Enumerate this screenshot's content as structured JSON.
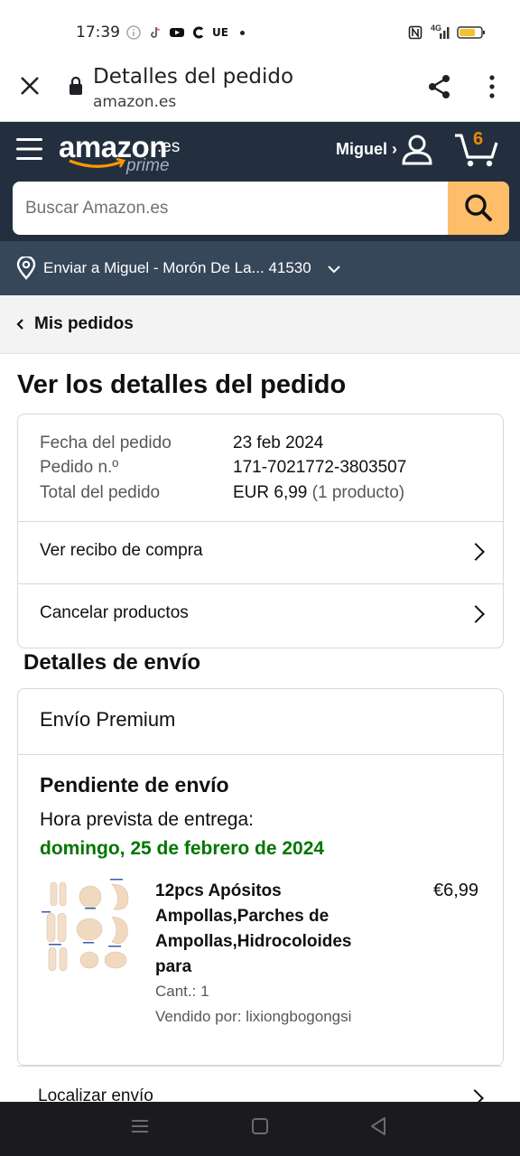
{
  "status_bar": {
    "time": "17:39",
    "icons": [
      "info-icon",
      "tiktok-icon",
      "youtube-icon",
      "c-icon",
      "ue-badge",
      "dot-icon",
      "nfc-icon",
      "signal-4g-icon",
      "battery-icon"
    ],
    "ue_label": "UE",
    "network_label": "4G"
  },
  "browser": {
    "title": "Detalles del pedido",
    "url": "amazon.es"
  },
  "header": {
    "logo_text": "amazon",
    "logo_suffix": ".es",
    "logo_prime": "prime",
    "account_label": "Miguel ›",
    "cart_count": "6",
    "search_placeholder": "Buscar Amazon.es",
    "deliver_to": "Enviar a Miguel - Morón De La... 41530"
  },
  "breadcrumb": {
    "label": "Mis pedidos"
  },
  "page": {
    "title": "Ver los detalles del pedido"
  },
  "order_summary": {
    "date_label": "Fecha del pedido",
    "date_value": "23 feb 2024",
    "order_label": "Pedido n.º",
    "order_value": "171-7021772-3803507",
    "total_label": "Total del pedido",
    "total_value": "EUR 6,99",
    "total_items": "(1 producto)",
    "receipt_link": "Ver recibo de compra",
    "cancel_link": "Cancelar productos"
  },
  "shipping": {
    "section_title": "Detalles de envío",
    "speed": "Envío Premium",
    "status": "Pendiente de envío",
    "eta_label": "Hora prevista de entrega:",
    "eta_date": "domingo, 25 de febrero de 2024",
    "product": {
      "title_lines": [
        "12pcs Apósitos",
        "Ampollas,Parches de",
        "Ampollas,Hidrocoloides",
        "para"
      ],
      "price": "€6,99",
      "qty": "Cant.: 1",
      "seller": "Vendido por: lixiongbogongsi"
    },
    "track_link": "Localizar envío"
  },
  "colors": {
    "header_dark": "#232f3e",
    "header_mid": "#37475a",
    "search_button": "#febd69",
    "eta_green": "#007600",
    "cart_orange": "#f08804"
  }
}
